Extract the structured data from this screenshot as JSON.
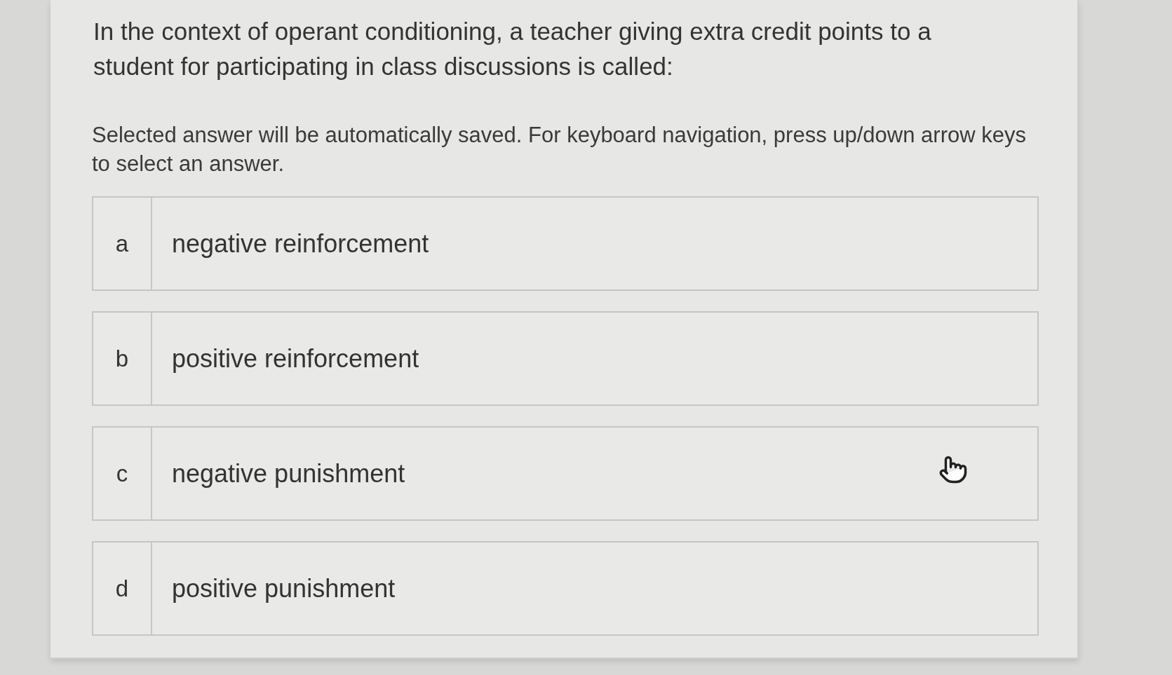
{
  "question": "In the context of operant conditioning, a teacher giving extra credit points to a student for participating in class discussions is called:",
  "instructions": "Selected answer will be automatically saved. For keyboard navigation, press up/down arrow keys to select an answer.",
  "options": [
    {
      "letter": "a",
      "text": "negative reinforcement",
      "selected": false
    },
    {
      "letter": "b",
      "text": "positive reinforcement",
      "selected": false
    },
    {
      "letter": "c",
      "text": "negative punishment",
      "selected": false
    },
    {
      "letter": "d",
      "text": "positive punishment",
      "selected": false
    }
  ]
}
